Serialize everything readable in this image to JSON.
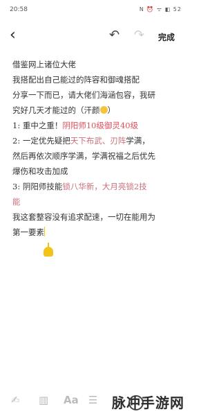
{
  "status": {
    "time": "20:58",
    "icons": "N ⏰ ᯤ ◧ 52"
  },
  "toolbar": {
    "done_label": "完成"
  },
  "note": {
    "lines": [
      [
        {
          "t": "借鉴网上诸位大佬",
          "c": ""
        }
      ],
      [
        {
          "t": "我搭配出自己能过的阵容和御魂搭配",
          "c": ""
        }
      ],
      [
        {
          "t": "分享一下而已，请大佬们海涵包容，我研",
          "c": ""
        }
      ],
      [
        {
          "t": "究好几天才能过的（汗颜",
          "c": ""
        },
        {
          "t": "",
          "c": "emoji"
        },
        {
          "t": "）",
          "c": ""
        }
      ],
      [
        {
          "t": "1:  重中之重！",
          "c": ""
        },
        {
          "t": "阴阳师10级御灵40级",
          "c": "red"
        }
      ],
      [
        {
          "t": "2:  一定优先疑把",
          "c": ""
        },
        {
          "t": "天下布武、刃阵",
          "c": "pink"
        },
        {
          "t": "学满，",
          "c": ""
        }
      ],
      [
        {
          "t": "然后再依次顺序学满，学满祝福之后优先",
          "c": ""
        }
      ],
      [
        {
          "t": "爆伤和攻击加成",
          "c": ""
        }
      ],
      [
        {
          "t": "3:  阴阳师技能",
          "c": ""
        },
        {
          "t": "锁八华新，大月亮锁2技",
          "c": "pink"
        }
      ],
      [
        {
          "t": "能",
          "c": "pink"
        }
      ],
      [
        {
          "t": "我这套整容没有追求配速，一切在能用为",
          "c": ""
        }
      ],
      [
        {
          "t": "第一要素",
          "c": ""
        },
        {
          "t": "",
          "c": "cursor"
        }
      ]
    ]
  },
  "bottom_bar": {
    "icons": [
      "format-icon",
      "layout-icon",
      "text-size-icon",
      "list-icon"
    ],
    "aa_label": "Aa"
  },
  "watermark": {
    "text": "脉冲手游网"
  }
}
